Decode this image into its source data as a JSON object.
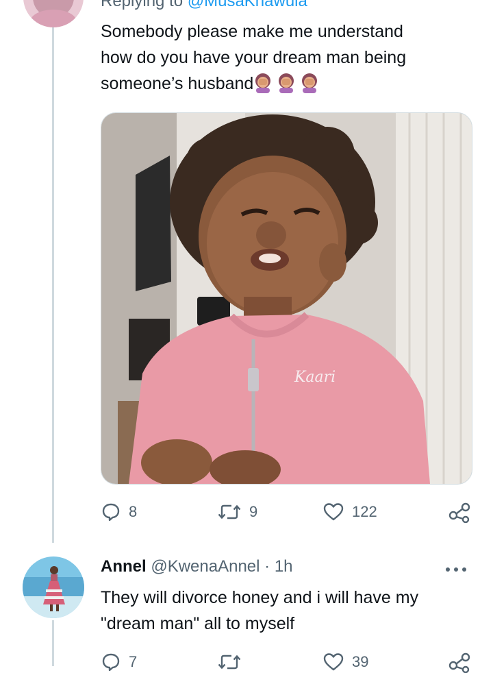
{
  "tweet": {
    "replying_prefix": "Replying to",
    "replying_handle": "@MusaKhawula",
    "text": "Somebody please make me understand how do you have your dream man being someone’s husband",
    "text_lines": [
      "Somebody please make me understand",
      "how do you have your dream man being",
      "someone’s husband"
    ],
    "emoji": "face-palm-emoji",
    "image_watermark": "Kaari",
    "actions": {
      "replies": "8",
      "retweets": "9",
      "likes": "122"
    }
  },
  "reply": {
    "name": "Annel",
    "handle": "@KwenaAnnel",
    "separator": "·",
    "time": "1h",
    "text_lines": [
      "They will divorce honey and i will have my",
      "\"dream man\" all to myself"
    ],
    "actions": {
      "replies": "7",
      "likes": "39"
    }
  },
  "colors": {
    "accent": "#1d9bf0",
    "muted": "#536471",
    "text": "#0f1419",
    "line": "#cfd9de"
  }
}
